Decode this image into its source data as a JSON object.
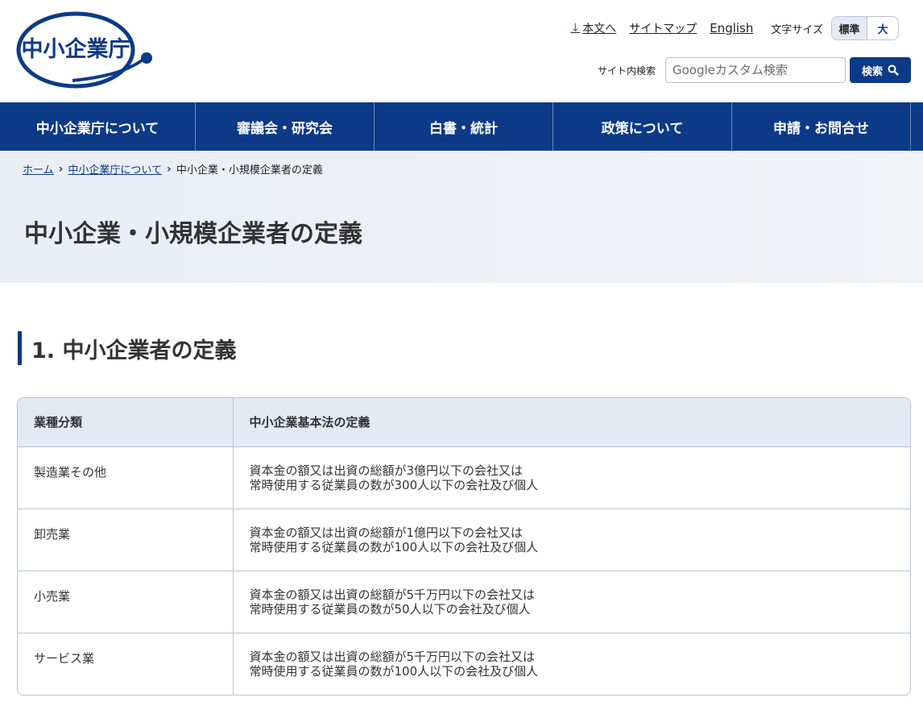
{
  "header": {
    "logo_text": "中小企業庁",
    "skip_link": "本文へ",
    "sitemap": "サイトマップ",
    "english": "English",
    "font_size_label": "文字サイズ",
    "font_size_standard": "標準",
    "font_size_large": "大",
    "search_label": "サイト内検索",
    "search_placeholder": "Googleカスタム検索",
    "search_button": "検索"
  },
  "nav": {
    "items": [
      {
        "label": "中小企業庁について"
      },
      {
        "label": "審議会・研究会"
      },
      {
        "label": "白書・統計"
      },
      {
        "label": "政策について"
      },
      {
        "label": "申請・お問合せ"
      }
    ]
  },
  "breadcrumb": {
    "home": "ホーム",
    "parent": "中小企業庁について",
    "current": "中小企業・小規模企業者の定義"
  },
  "page_title": "中小企業・小規模企業者の定義",
  "section": {
    "title": "1. 中小企業者の定義"
  },
  "table": {
    "headers": [
      "業種分類",
      "中小企業基本法の定義"
    ],
    "rows": [
      {
        "category": "製造業その他",
        "line1": "資本金の額又は出資の総額が3億円以下の会社又は",
        "line2": "常時使用する従業員の数が300人以下の会社及び個人"
      },
      {
        "category": "卸売業",
        "line1": "資本金の額又は出資の総額が1億円以下の会社又は",
        "line2": "常時使用する従業員の数が100人以下の会社及び個人"
      },
      {
        "category": "小売業",
        "line1": "資本金の額又は出資の総額が5千万円以下の会社又は",
        "line2": "常時使用する従業員の数が50人以下の会社及び個人"
      },
      {
        "category": "サービス業",
        "line1": "資本金の額又は出資の総額が5千万円以下の会社又は",
        "line2": "常時使用する従業員の数が100人以下の会社及び個人"
      }
    ]
  },
  "colors": {
    "brand": "#0c3a87",
    "hero_bg": "#e9eef5",
    "table_header_bg": "#e4eaf3"
  }
}
